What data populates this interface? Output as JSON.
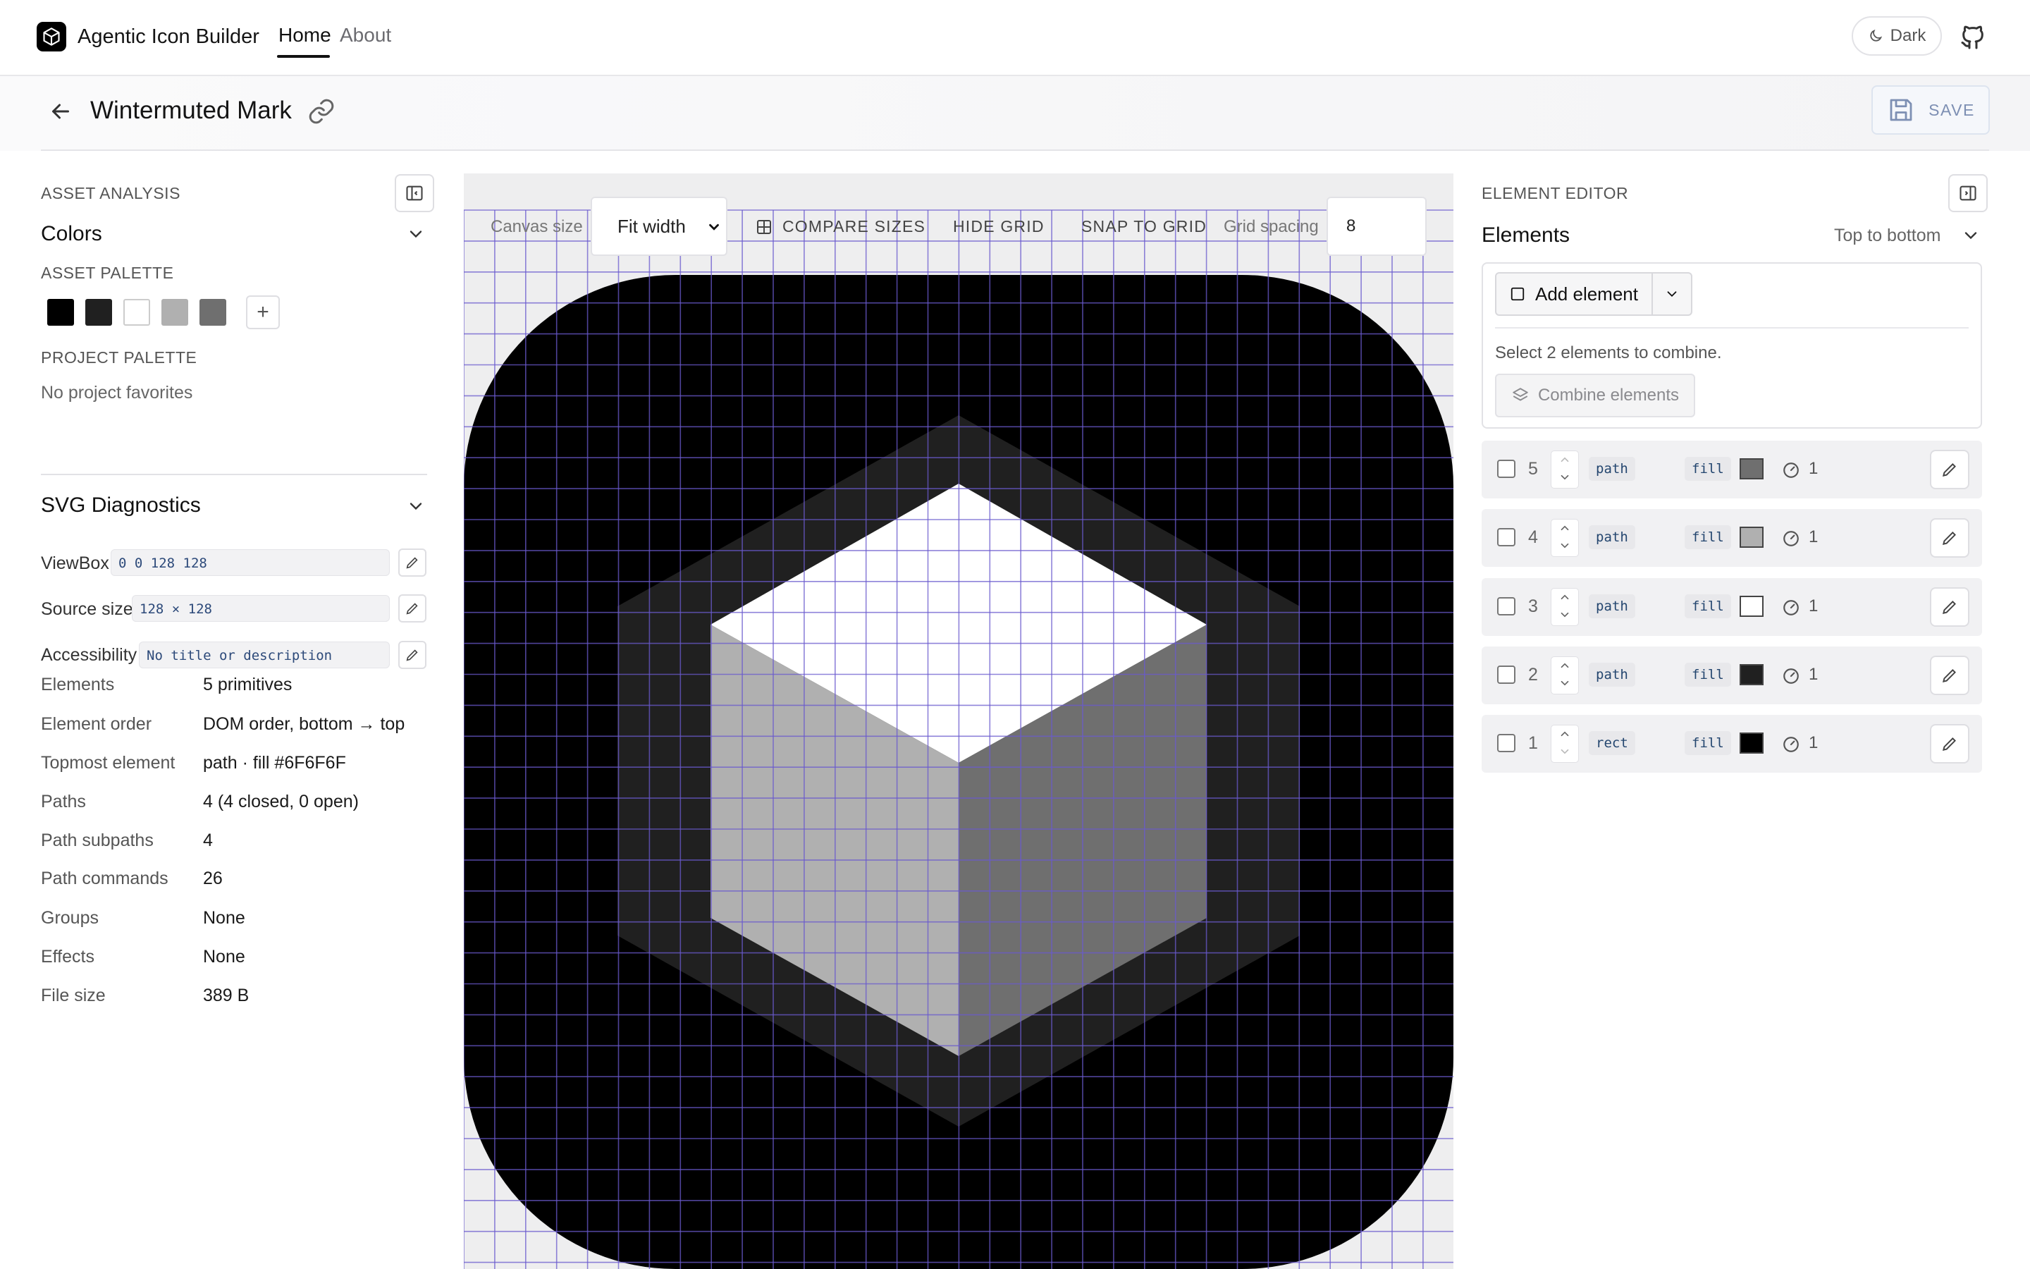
{
  "app": {
    "brand": "Agentic Icon Builder",
    "nav": [
      {
        "label": "Home",
        "active": true
      },
      {
        "label": "About",
        "active": false
      }
    ],
    "theme_button": "Dark"
  },
  "header": {
    "title": "Wintermuted Mark",
    "save_label": "SAVE"
  },
  "left": {
    "section_title": "ASSET ANALYSIS",
    "colors_heading": "Colors",
    "asset_palette_label": "ASSET PALETTE",
    "asset_palette": [
      "#000000",
      "#202020",
      "#FFFFFF",
      "#B0B0B0",
      "#6F6F6F"
    ],
    "project_palette_label": "PROJECT PALETTE",
    "project_palette_empty": "No project favorites",
    "diag_heading": "SVG Diagnostics",
    "viewbox_label": "ViewBox",
    "viewbox_value": "0 0 128 128",
    "source_label": "Source size",
    "source_value": "128 × 128",
    "access_label": "Accessibility",
    "access_value": "No title or description",
    "stats": [
      {
        "label": "Elements",
        "value": "5 primitives"
      },
      {
        "label": "Element order",
        "value": "DOM order, bottom → top"
      },
      {
        "label": "Topmost element",
        "value": "path · fill #6F6F6F"
      },
      {
        "label": "Paths",
        "value": "4 (4 closed, 0 open)"
      },
      {
        "label": "Path subpaths",
        "value": "4"
      },
      {
        "label": "Path commands",
        "value": "26"
      },
      {
        "label": "Groups",
        "value": "None"
      },
      {
        "label": "Effects",
        "value": "None"
      },
      {
        "label": "File size",
        "value": "389 B"
      }
    ]
  },
  "canvas": {
    "size_label": "Canvas size",
    "size_value": "Fit width",
    "compare_label": "COMPARE SIZES",
    "grid_label": "HIDE GRID",
    "snap_label": "SNAP TO GRID",
    "spacing_label": "Grid spacing",
    "spacing_value": "8",
    "colors": {
      "bg": "#000000",
      "hex": "#202020",
      "top": "#FFFFFF",
      "left": "#B0B0B0",
      "right": "#6F6F6F",
      "grid": "#6a5acd"
    }
  },
  "right": {
    "section_title": "ELEMENT EDITOR",
    "elements_heading": "Elements",
    "sort_label": "Top to bottom",
    "add_label": "Add element",
    "combine_hint": "Select 2 elements to combine.",
    "combine_label": "Combine elements",
    "rows": [
      {
        "index": "5",
        "type": "path",
        "fill_label": "fill",
        "color": "#6F6F6F",
        "opacity": "1"
      },
      {
        "index": "4",
        "type": "path",
        "fill_label": "fill",
        "color": "#B0B0B0",
        "opacity": "1"
      },
      {
        "index": "3",
        "type": "path",
        "fill_label": "fill",
        "color": "#FFFFFF",
        "opacity": "1"
      },
      {
        "index": "2",
        "type": "path",
        "fill_label": "fill",
        "color": "#202020",
        "opacity": "1"
      },
      {
        "index": "1",
        "type": "rect",
        "fill_label": "fill",
        "color": "#000000",
        "opacity": "1"
      }
    ]
  }
}
